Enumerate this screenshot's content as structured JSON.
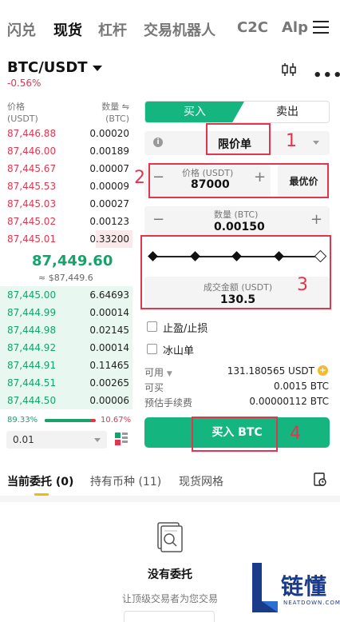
{
  "nav": {
    "tabs": [
      {
        "label": "闪兑"
      },
      {
        "label": "现货"
      },
      {
        "label": "杠杆"
      },
      {
        "label": "交易机器人"
      },
      {
        "label": "C2C"
      },
      {
        "label": "Alp"
      }
    ],
    "active_tab": "现货"
  },
  "pair": {
    "symbol": "BTC/USDT",
    "change": "-0.56%"
  },
  "orderbook": {
    "price_header": "价格",
    "price_unit": "(USDT)",
    "qty_header": "数量 ⇋",
    "qty_unit": "(BTC)",
    "asks": [
      {
        "price": "87,446.88",
        "qty": "0.00020"
      },
      {
        "price": "87,446.00",
        "qty": "0.00189"
      },
      {
        "price": "87,445.67",
        "qty": "0.00007"
      },
      {
        "price": "87,445.53",
        "qty": "0.00009"
      },
      {
        "price": "87,445.03",
        "qty": "0.00027"
      },
      {
        "price": "87,445.02",
        "qty": "0.00123"
      },
      {
        "price": "87,445.01",
        "qty": "0.33200"
      }
    ],
    "mid_price": "87,449.60",
    "mid_usd": "≈ $87,449.6",
    "bids": [
      {
        "price": "87,445.00",
        "qty": "6.64693"
      },
      {
        "price": "87,444.99",
        "qty": "0.00014"
      },
      {
        "price": "87,444.98",
        "qty": "0.02145"
      },
      {
        "price": "87,444.92",
        "qty": "0.00014"
      },
      {
        "price": "87,444.91",
        "qty": "0.11465"
      },
      {
        "price": "87,444.51",
        "qty": "0.00265"
      },
      {
        "price": "87,444.50",
        "qty": "0.00006"
      }
    ],
    "buy_ratio": "89.33%",
    "sell_ratio": "10.67%",
    "buy_ratio_value": 89.33,
    "precision": "0.01"
  },
  "form": {
    "buy_tab": "买入",
    "sell_tab": "卖出",
    "order_type": "限价单",
    "price_label": "价格 (USDT)",
    "price_value": "87000",
    "best_price": "最优价",
    "qty_label": "数量 (BTC)",
    "qty_value": "0.00150",
    "amount_label": "成交金额 (USDT)",
    "amount_value": "130.5",
    "tpsl_label": "止盈/止损",
    "iceberg_label": "冰山单",
    "available_label": "可用",
    "available_value": "131.180565 USDT",
    "canbuy_label": "可买",
    "canbuy_value": "0.0015 BTC",
    "fee_label": "预估手续费",
    "fee_value": "0.00000112 BTC",
    "buy_button": "买入 BTC"
  },
  "annotations": {
    "n1": "1",
    "n2": "2",
    "n3": "3",
    "n4": "4"
  },
  "bottom": {
    "tabs": [
      {
        "label": "当前委托 (0)"
      },
      {
        "label": "持有币种 (11)"
      },
      {
        "label": "现货网格"
      }
    ],
    "empty_title": "没有委托",
    "empty_sub": "让顶级交易者为您交易"
  },
  "watermark": {
    "title": "链懂",
    "sub": "NEATDOWN.COM"
  },
  "colors": {
    "buy": "#14b57e",
    "sell": "#e0364f",
    "annotation": "#e0364f"
  }
}
